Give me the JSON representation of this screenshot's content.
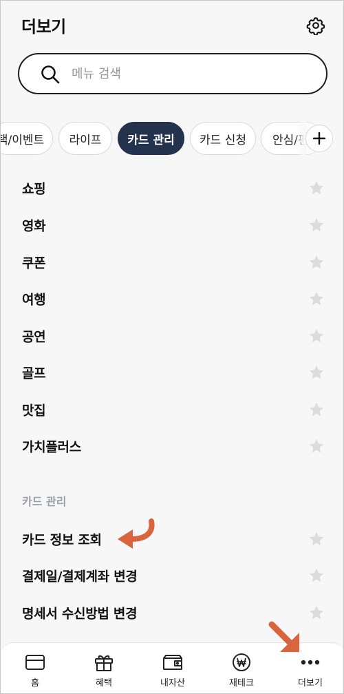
{
  "header": {
    "title": "더보기",
    "settings_icon": "gear-icon"
  },
  "search": {
    "placeholder": "메뉴 검색",
    "value": ""
  },
  "chips": [
    {
      "label": "택/이벤트",
      "active": false
    },
    {
      "label": "라이프",
      "active": false
    },
    {
      "label": "카드 관리",
      "active": true
    },
    {
      "label": "카드 신청",
      "active": false
    },
    {
      "label": "안심/편",
      "active": false
    }
  ],
  "lifestyle_items": [
    {
      "label": "쇼핑"
    },
    {
      "label": "영화"
    },
    {
      "label": "쿠폰"
    },
    {
      "label": "여행"
    },
    {
      "label": "공연"
    },
    {
      "label": "골프"
    },
    {
      "label": "맛집"
    },
    {
      "label": "가치플러스"
    }
  ],
  "card_section": {
    "title": "카드 관리",
    "items": [
      {
        "label": "카드 정보 조회"
      },
      {
        "label": "결제일/결제계좌 변경"
      },
      {
        "label": "명세서 수신방법 변경"
      }
    ]
  },
  "tabbar": {
    "tabs": [
      {
        "label": "홈",
        "icon": "card-icon"
      },
      {
        "label": "혜택",
        "icon": "gift-icon"
      },
      {
        "label": "내자산",
        "icon": "wallet-icon"
      },
      {
        "label": "재테크",
        "icon": "won-coin-icon"
      },
      {
        "label": "더보기",
        "icon": "more-dots-icon"
      }
    ]
  },
  "colors": {
    "accent": "#24334d",
    "annotation_arrow": "#d9643f",
    "star": "#dcdcdc",
    "section_title": "#9aa0a8"
  }
}
